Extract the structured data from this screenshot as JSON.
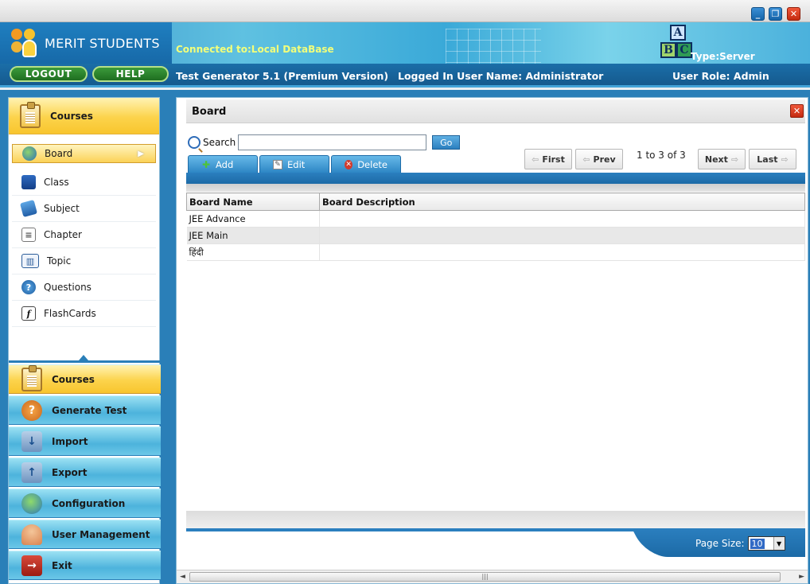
{
  "window": {
    "minimize": "_",
    "maximize": "❐",
    "close": "✕"
  },
  "header": {
    "brand": "MERIT STUDENTS",
    "connected": "Connected to:Local DataBase",
    "abc": [
      "A",
      "B",
      "C"
    ],
    "type": "Type:Server"
  },
  "toolbar": {
    "logout": "LOGOUT",
    "help": "HELP",
    "app_version": "Test Generator 5.1 (Premium Version)",
    "logged_in": "Logged In User Name:  Administrator",
    "user_role": "User Role: Admin"
  },
  "sidebar": {
    "section_title": "Courses",
    "items": [
      {
        "label": "Board",
        "icon": "globe-icon"
      },
      {
        "label": "Class",
        "icon": "book-icon"
      },
      {
        "label": "Subject",
        "icon": "subject-icon"
      },
      {
        "label": "Chapter",
        "icon": "chapter-icon"
      },
      {
        "label": "Topic",
        "icon": "topic-icon"
      },
      {
        "label": "Questions",
        "icon": "question-icon"
      },
      {
        "label": "FlashCards",
        "icon": "flashcard-icon"
      }
    ],
    "nav": [
      {
        "label": "Courses",
        "icon": "clipboard-icon"
      },
      {
        "label": "Generate Test",
        "icon": "question-icon"
      },
      {
        "label": "Import",
        "icon": "import-icon"
      },
      {
        "label": "Export",
        "icon": "export-icon"
      },
      {
        "label": "Configuration",
        "icon": "globe-config-icon"
      },
      {
        "label": "User Management",
        "icon": "user-icon"
      },
      {
        "label": "Exit",
        "icon": "exit-icon"
      }
    ]
  },
  "panel": {
    "title": "Board",
    "close": "✕",
    "search_label": "Search",
    "search_value": "",
    "go": "Go",
    "actions": {
      "add": "Add",
      "edit": "Edit",
      "delete": "Delete"
    },
    "pager": {
      "first": "First",
      "prev": "Prev",
      "range": "1 to 3 of 3",
      "next": "Next",
      "last": "Last"
    },
    "columns": [
      "Board Name",
      "Board Description"
    ],
    "rows": [
      [
        "JEE Advance",
        ""
      ],
      [
        "JEE Main",
        ""
      ],
      [
        "हिंदी",
        ""
      ]
    ],
    "page_size_label": "Page Size:",
    "page_size_value": "10"
  },
  "colors": {
    "accent_blue": "#2a7fb8",
    "header_yellow": "#fcd34b",
    "close_red": "#c42a10"
  }
}
